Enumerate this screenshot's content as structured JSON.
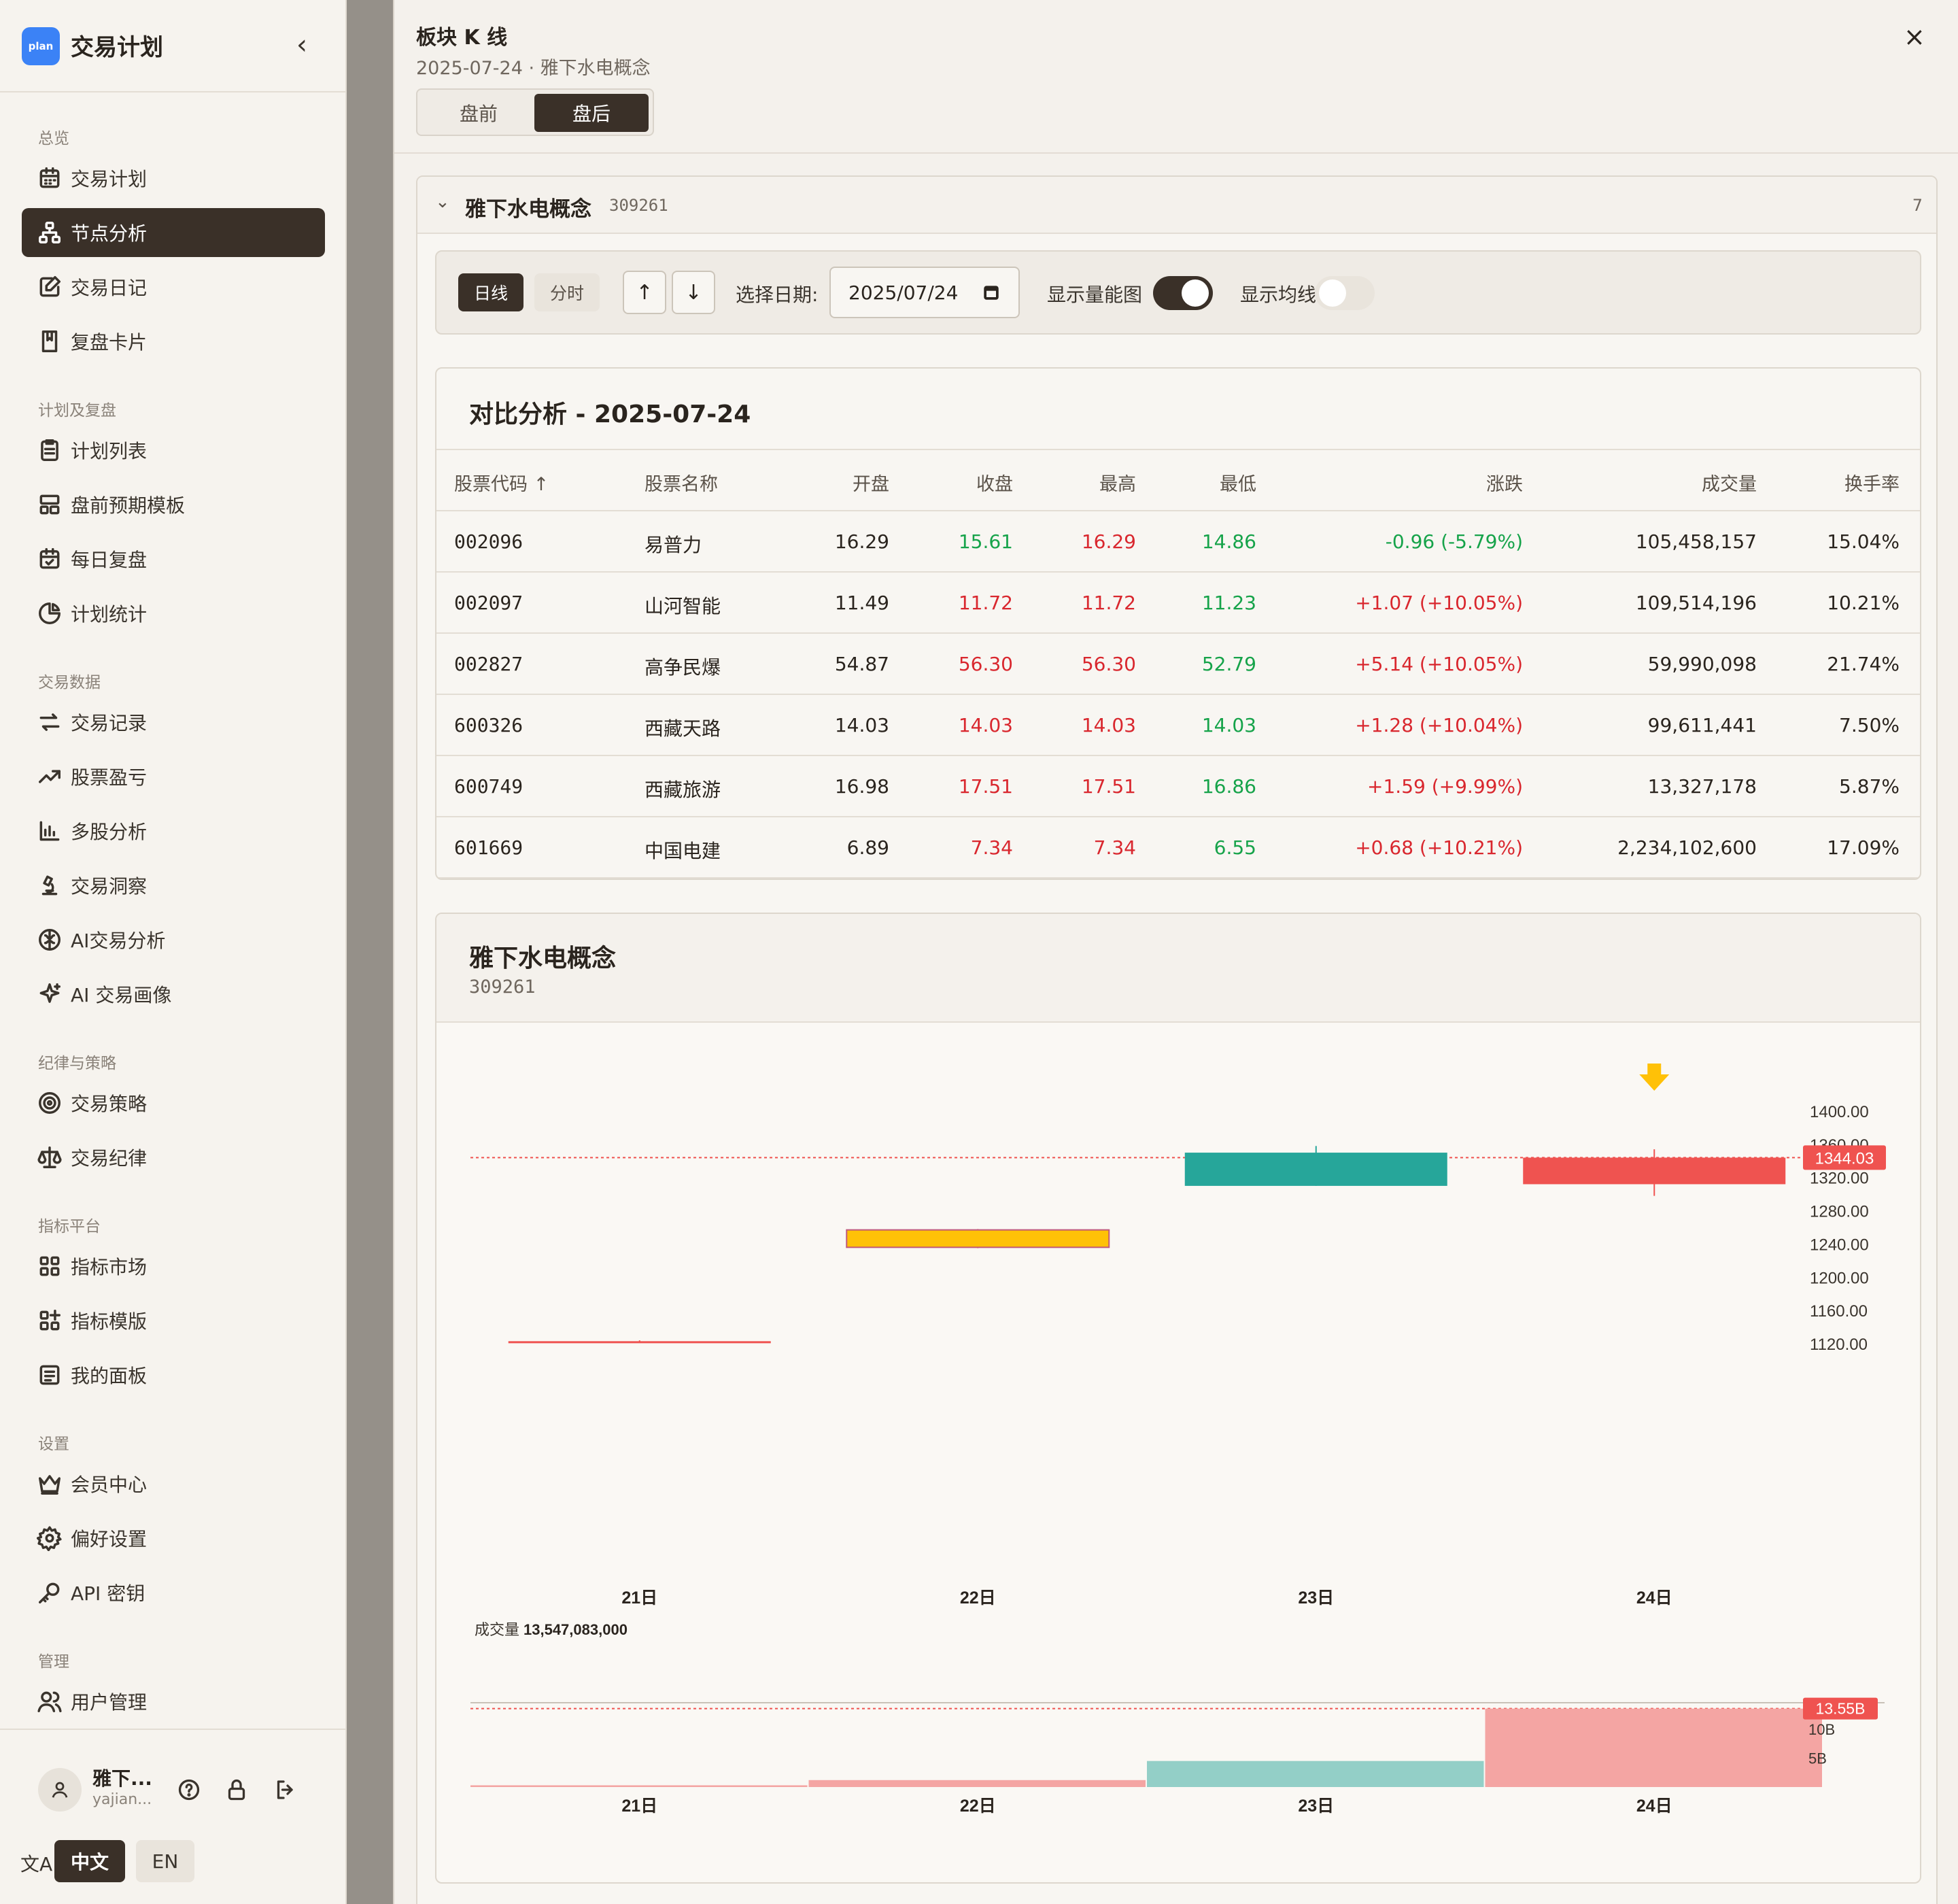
{
  "app": {
    "logo": "plan",
    "title": "交易计划",
    "collapse_icon": "chevron-left-icon"
  },
  "nav": [
    {
      "type": "group",
      "label": "总览"
    },
    {
      "type": "item",
      "label": "交易计划",
      "icon": "calendar-icon"
    },
    {
      "type": "item",
      "label": "节点分析",
      "icon": "nodes-icon",
      "active": true
    },
    {
      "type": "item",
      "label": "交易日记",
      "icon": "edit-icon"
    },
    {
      "type": "item",
      "label": "复盘卡片",
      "icon": "book-icon"
    },
    {
      "type": "group",
      "label": "计划及复盘"
    },
    {
      "type": "item",
      "label": "计划列表",
      "icon": "clipboard-icon"
    },
    {
      "type": "item",
      "label": "盘前预期模板",
      "icon": "layout-icon"
    },
    {
      "type": "item",
      "label": "每日复盘",
      "icon": "calendar-check-icon"
    },
    {
      "type": "item",
      "label": "计划统计",
      "icon": "pie-icon"
    },
    {
      "type": "group",
      "label": "交易数据"
    },
    {
      "type": "item",
      "label": "交易记录",
      "icon": "swap-icon"
    },
    {
      "type": "item",
      "label": "股票盈亏",
      "icon": "trend-icon"
    },
    {
      "type": "item",
      "label": "多股分析",
      "icon": "bar-chart-icon"
    },
    {
      "type": "item",
      "label": "交易洞察",
      "icon": "microscope-icon"
    },
    {
      "type": "item",
      "label": "AI交易分析",
      "icon": "brain-icon"
    },
    {
      "type": "item",
      "label": "AI 交易画像",
      "icon": "sparkle-icon"
    },
    {
      "type": "group",
      "label": "纪律与策略"
    },
    {
      "type": "item",
      "label": "交易策略",
      "icon": "target-icon"
    },
    {
      "type": "item",
      "label": "交易纪律",
      "icon": "scale-icon"
    },
    {
      "type": "group",
      "label": "指标平台"
    },
    {
      "type": "item",
      "label": "指标市场",
      "icon": "grid-icon"
    },
    {
      "type": "item",
      "label": "指标模版",
      "icon": "grid-plus-icon"
    },
    {
      "type": "item",
      "label": "我的面板",
      "icon": "panel-icon"
    },
    {
      "type": "group",
      "label": "设置"
    },
    {
      "type": "item",
      "label": "会员中心",
      "icon": "crown-icon"
    },
    {
      "type": "item",
      "label": "偏好设置",
      "icon": "gear-icon"
    },
    {
      "type": "item",
      "label": "API 密钥",
      "icon": "key-icon"
    },
    {
      "type": "group",
      "label": "管理"
    },
    {
      "type": "item",
      "label": "用户管理",
      "icon": "users-icon"
    }
  ],
  "user": {
    "name": "雅下...",
    "sub": "yajian...",
    "icons": [
      "help-icon",
      "lock-icon",
      "logout-icon"
    ]
  },
  "lang": {
    "icon": "translate-icon",
    "zh": "中文",
    "en": "EN"
  },
  "drawer": {
    "title": "板块 K 线",
    "subtitle": "2025-07-24 · 雅下水电概念",
    "tabs": [
      "盘前",
      "盘后"
    ],
    "active_tab": "盘后",
    "close": "×"
  },
  "panel": {
    "name": "雅下水电概念",
    "code": "309261",
    "count": "7"
  },
  "toolbar": {
    "day": "日线",
    "minute": "分时",
    "up": "↑",
    "down": "↓",
    "date_label": "选择日期:",
    "date_value": "2025/07/24",
    "volume_label": "显示量能图",
    "volume_on": true,
    "ma_label": "显示均线",
    "ma_on": false
  },
  "comparison": {
    "title": "对比分析 - 2025-07-24",
    "headers": [
      "股票代码 ↑",
      "股票名称",
      "开盘",
      "收盘",
      "最高",
      "最低",
      "涨跌",
      "成交量",
      "换手率"
    ],
    "rows": [
      {
        "code": "002096",
        "name": "易普力",
        "open": "16.29",
        "close": "15.61",
        "high": "16.29",
        "low": "14.86",
        "change": "-0.96 (-5.79%)",
        "volume": "105,458,157",
        "turnover": "15.04%",
        "close_c": "green",
        "high_c": "red",
        "low_c": "green",
        "change_c": "green"
      },
      {
        "code": "002097",
        "name": "山河智能",
        "open": "11.49",
        "close": "11.72",
        "high": "11.72",
        "low": "11.23",
        "change": "+1.07 (+10.05%)",
        "volume": "109,514,196",
        "turnover": "10.21%",
        "close_c": "red",
        "high_c": "red",
        "low_c": "green",
        "change_c": "red"
      },
      {
        "code": "002827",
        "name": "高争民爆",
        "open": "54.87",
        "close": "56.30",
        "high": "56.30",
        "low": "52.79",
        "change": "+5.14 (+10.05%)",
        "volume": "59,990,098",
        "turnover": "21.74%",
        "close_c": "red",
        "high_c": "red",
        "low_c": "green",
        "change_c": "red"
      },
      {
        "code": "600326",
        "name": "西藏天路",
        "open": "14.03",
        "close": "14.03",
        "high": "14.03",
        "low": "14.03",
        "change": "+1.28 (+10.04%)",
        "volume": "99,611,441",
        "turnover": "7.50%",
        "close_c": "red",
        "high_c": "red",
        "low_c": "green",
        "change_c": "red"
      },
      {
        "code": "600749",
        "name": "西藏旅游",
        "open": "16.98",
        "close": "17.51",
        "high": "17.51",
        "low": "16.86",
        "change": "+1.59 (+9.99%)",
        "volume": "13,327,178",
        "turnover": "5.87%",
        "close_c": "red",
        "high_c": "red",
        "low_c": "green",
        "change_c": "red"
      },
      {
        "code": "601669",
        "name": "中国电建",
        "open": "6.89",
        "close": "7.34",
        "high": "7.34",
        "low": "6.55",
        "change": "+0.68 (+10.21%)",
        "volume": "2,234,102,600",
        "turnover": "17.09%",
        "close_c": "red",
        "high_c": "red",
        "low_c": "green",
        "change_c": "red"
      }
    ]
  },
  "colors": {
    "up": "#ef5350",
    "down": "#26a69a",
    "flat": "#ffc107",
    "up_text": "#d9272e",
    "down_text": "#16a34a",
    "marker": "#ffc107"
  },
  "chart_data": {
    "type": "candlestick",
    "title": "雅下水电概念",
    "subtitle": "309261",
    "categories": [
      "21日",
      "22日",
      "23日",
      "24日"
    ],
    "ohlc": [
      {
        "open": 1123,
        "high": 1124,
        "low": 1121,
        "close": 1123
      },
      {
        "open": 1257,
        "high": 1258,
        "low": 1235,
        "close": 1236
      },
      {
        "open": 1350,
        "high": 1358,
        "low": 1310,
        "close": 1310
      },
      {
        "open": 1344,
        "high": 1354,
        "low": 1298,
        "close": 1312
      }
    ],
    "yticks": [
      "1400.00",
      "1360.00",
      "1320.00",
      "1280.00",
      "1240.00",
      "1200.00",
      "1160.00",
      "1120.00"
    ],
    "ylim": [
      1110,
      1410
    ],
    "last_price_label": "1344.03",
    "last_price": 1344.03,
    "marker_on": "24日",
    "volume": {
      "label": "成交量",
      "total_label": "13,547,083,000",
      "values": [
        0.3,
        1.2,
        4.5,
        13.55
      ],
      "colors": [
        "up",
        "up",
        "down",
        "up"
      ],
      "yticks": [
        "10B",
        "5B"
      ],
      "last_label": "13.55B",
      "ylim": [
        0,
        14
      ]
    }
  }
}
